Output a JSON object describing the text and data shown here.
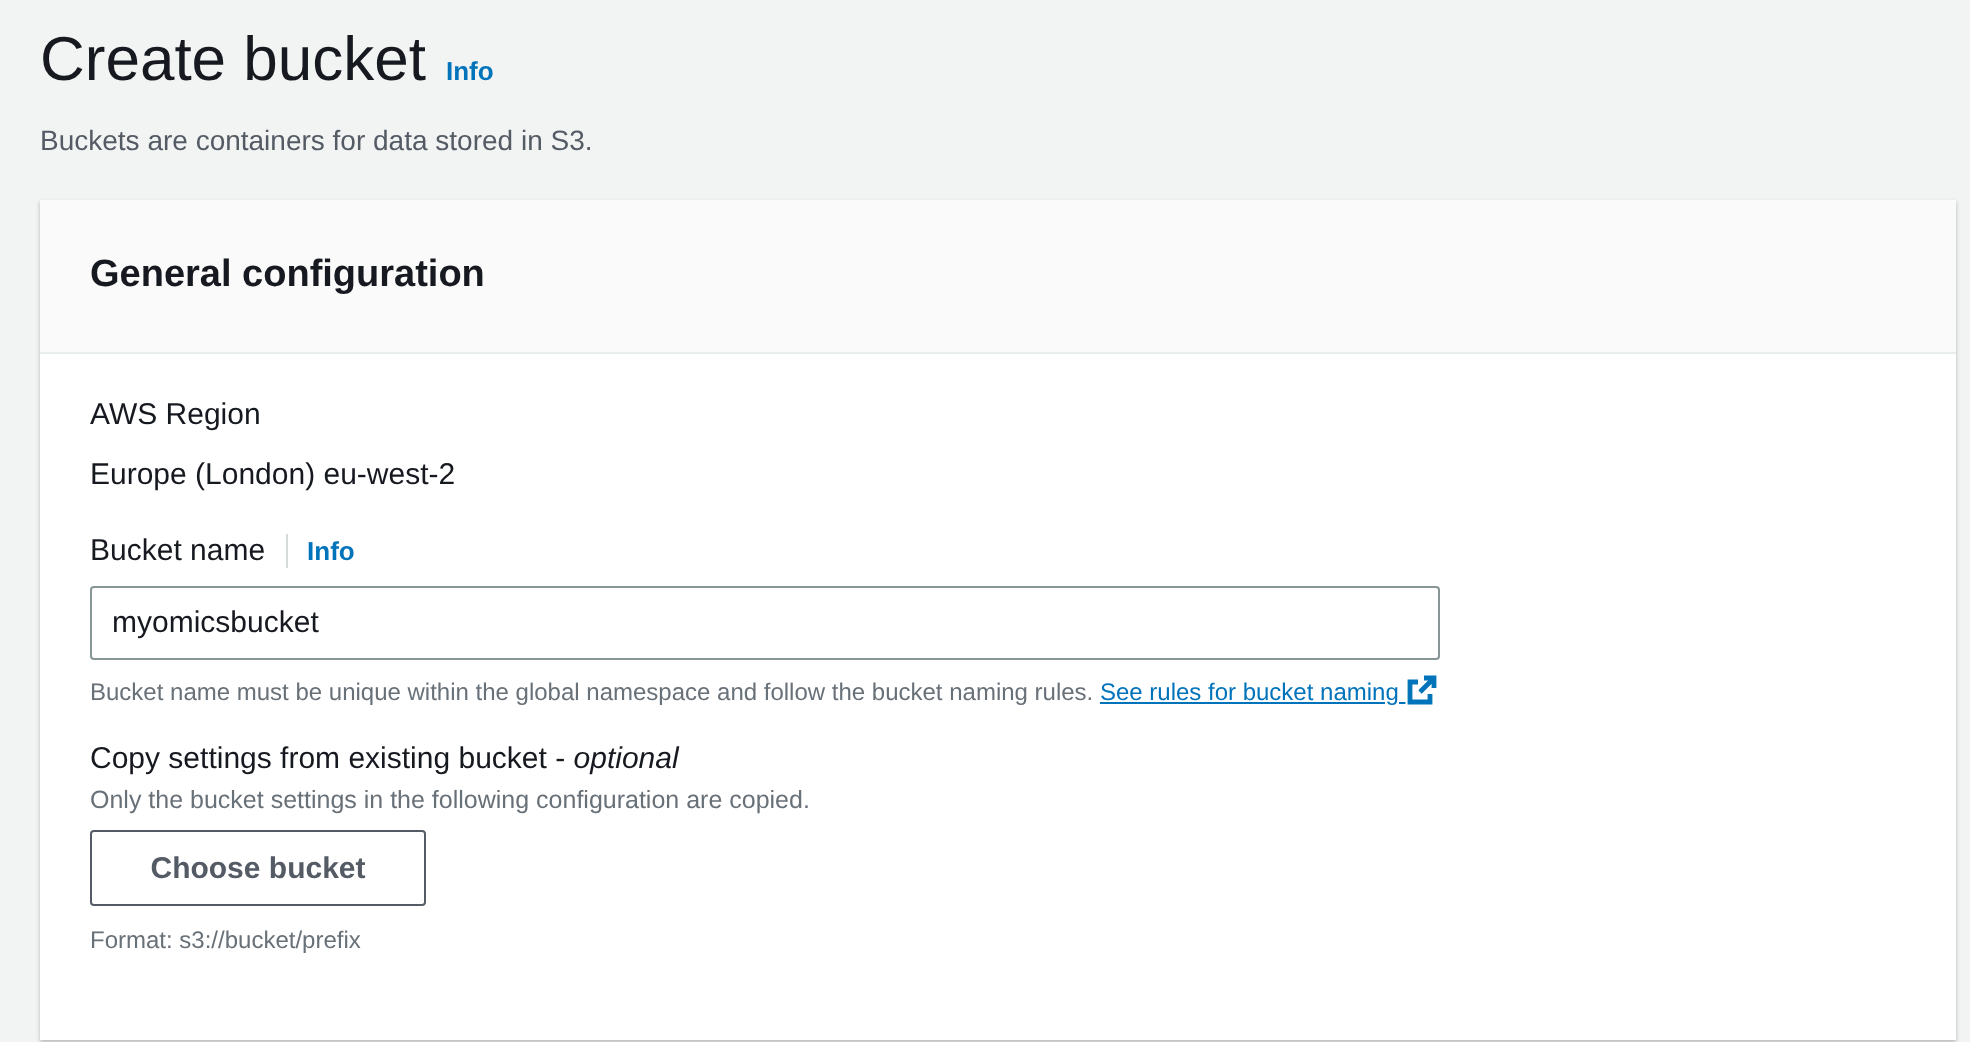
{
  "page": {
    "title": "Create bucket",
    "info_link": "Info",
    "description": "Buckets are containers for data stored in S3."
  },
  "panel": {
    "title": "General configuration",
    "region": {
      "label": "AWS Region",
      "value": "Europe (London) eu-west-2"
    },
    "bucket_name": {
      "label": "Bucket name",
      "info_link": "Info",
      "value": "myomicsbucket",
      "hint": "Bucket name must be unique within the global namespace and follow the bucket naming rules.",
      "hint_link": "See rules for bucket naming"
    },
    "copy_settings": {
      "label": "Copy settings from existing bucket - *optional*",
      "description": "Only the bucket settings in the following configuration are copied.",
      "button": "Choose bucket",
      "format": "Format: s3://bucket/prefix"
    }
  }
}
